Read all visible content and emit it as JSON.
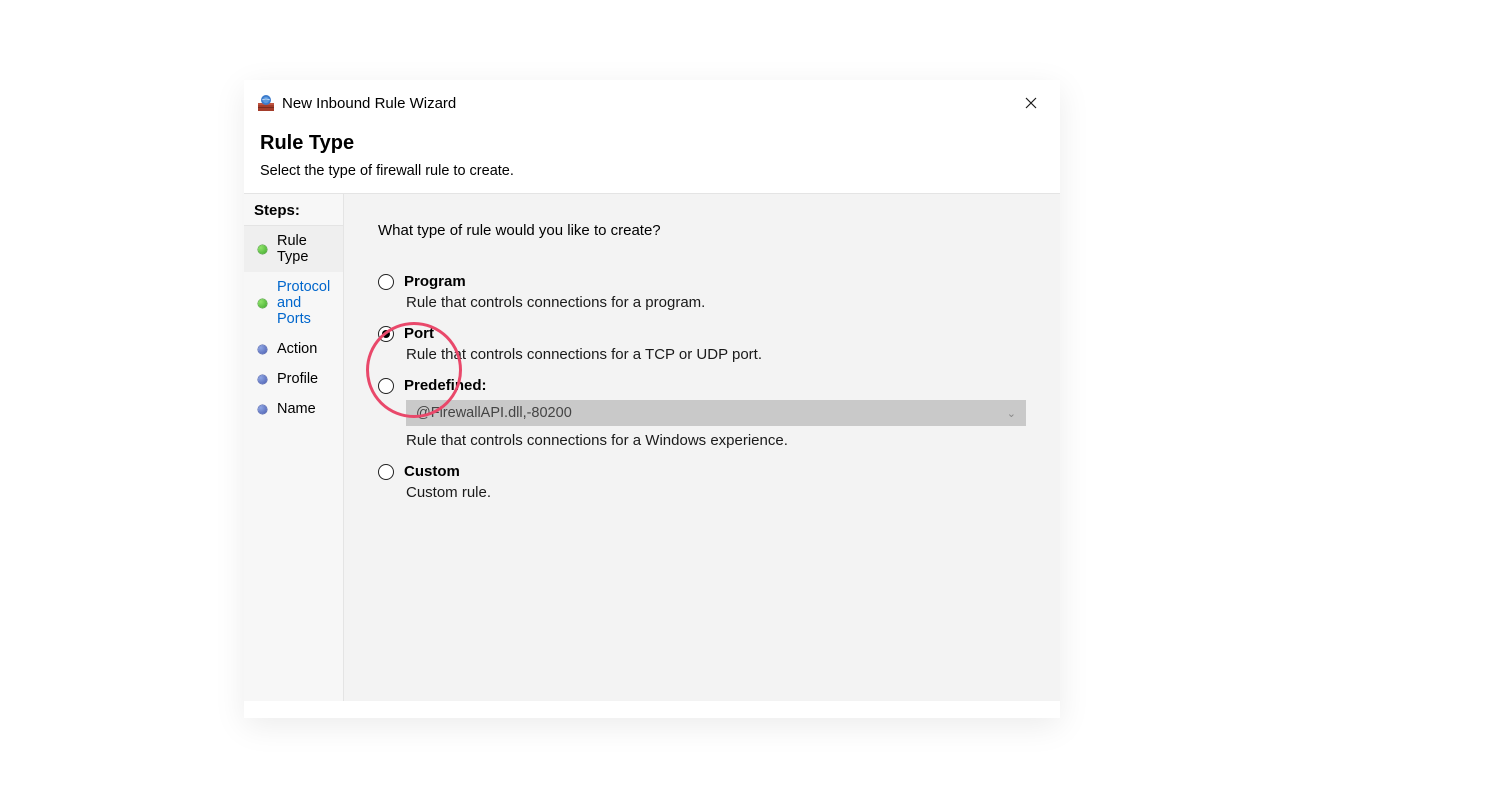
{
  "window": {
    "title": "New Inbound Rule Wizard"
  },
  "header": {
    "heading": "Rule Type",
    "description": "Select the type of firewall rule to create."
  },
  "steps": {
    "header": "Steps:",
    "items": [
      {
        "label": "Rule Type"
      },
      {
        "label": "Protocol and Ports"
      },
      {
        "label": "Action"
      },
      {
        "label": "Profile"
      },
      {
        "label": "Name"
      }
    ]
  },
  "content": {
    "question": "What type of rule would you like to create?",
    "options": {
      "program": {
        "label": "Program",
        "desc": "Rule that controls connections for a program."
      },
      "port": {
        "label": "Port",
        "desc": "Rule that controls connections for a TCP or UDP port."
      },
      "predefined": {
        "label": "Predefined:",
        "select_value": "@FirewallAPI.dll,-80200",
        "desc": "Rule that controls connections for a Windows experience."
      },
      "custom": {
        "label": "Custom",
        "desc": "Custom rule."
      }
    }
  }
}
